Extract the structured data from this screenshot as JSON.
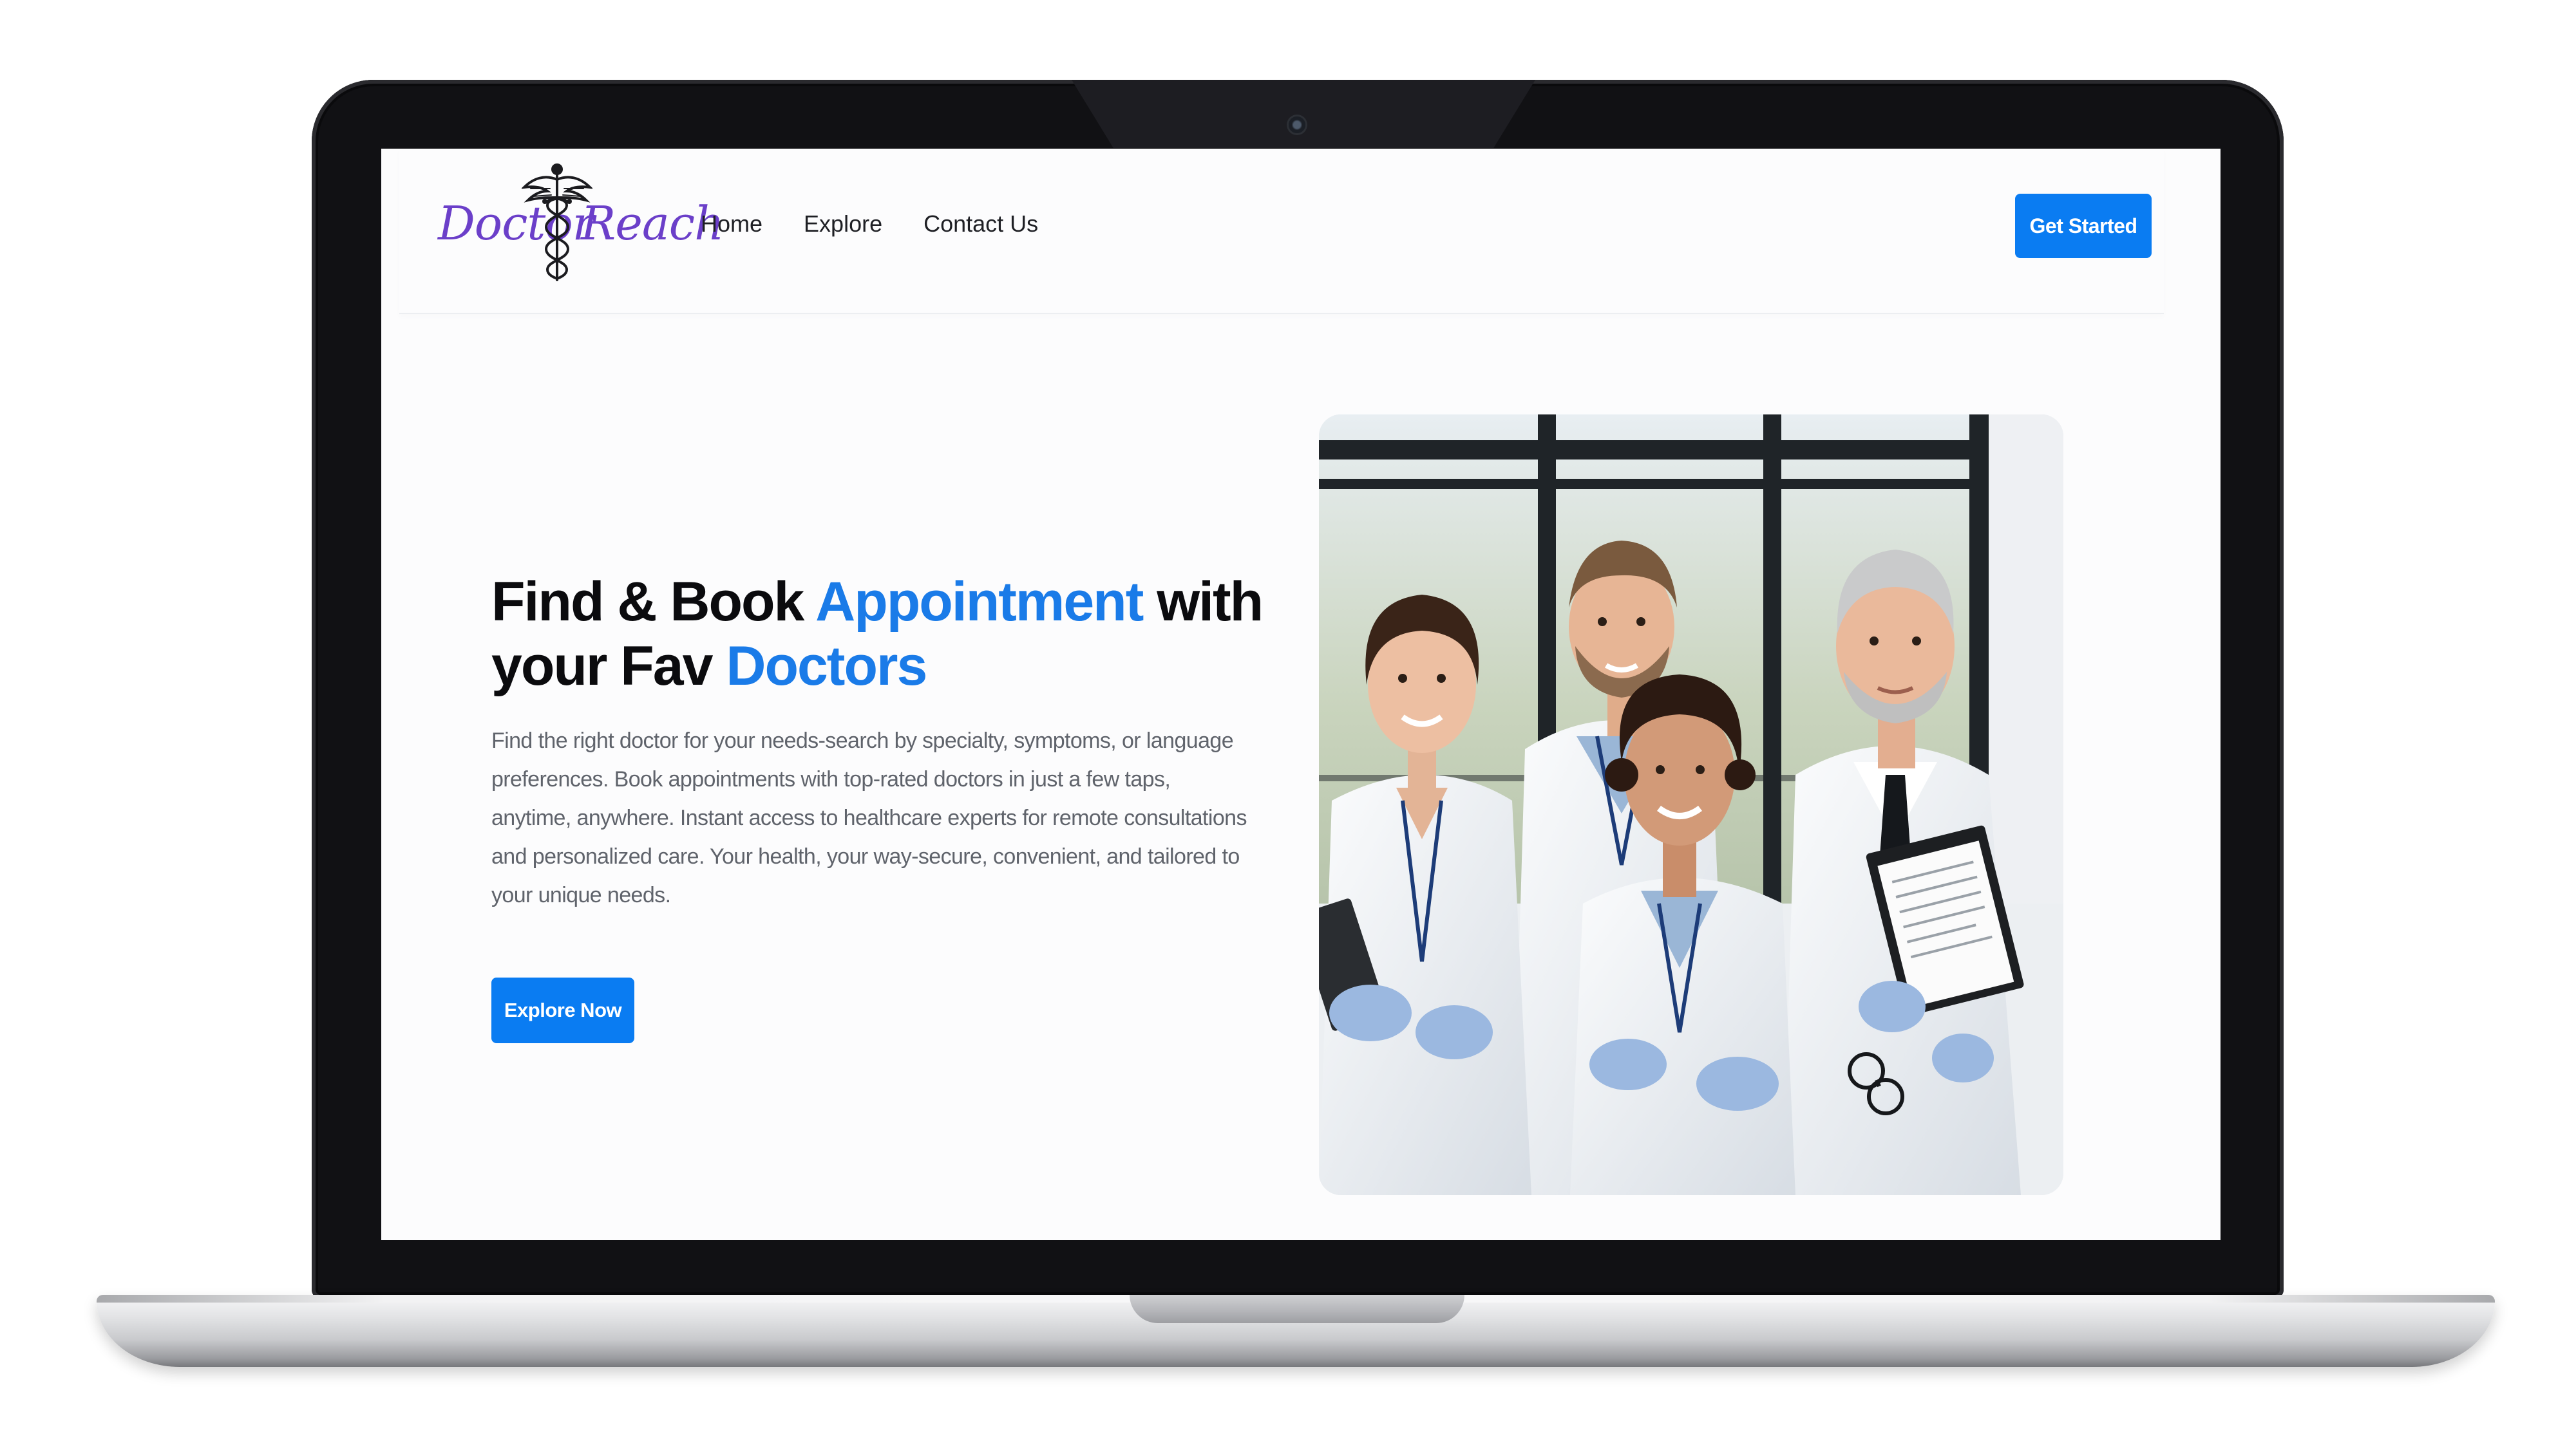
{
  "brand": {
    "logo_word_left": "Doctor",
    "logo_word_right": "Reach"
  },
  "nav": {
    "links": [
      "Home",
      "Explore",
      "Contact Us"
    ],
    "cta": "Get Started"
  },
  "hero": {
    "title_part1": "Find & Book ",
    "title_accent1": "Appointment",
    "title_part2": " with your Fav ",
    "title_accent2": "Doctors",
    "description": "Find the right doctor for your needs-search by specialty, symptoms, or language preferences. Book appointments with top-rated doctors in just a few taps, anytime, anywhere. Instant access to healthcare experts for remote consultations and personalized care. Your health, your way-secure, convenient, and tailored to your unique needs.",
    "button": "Explore Now"
  },
  "colors": {
    "accent": "#1a7be8",
    "button": "#0a7cf2",
    "logo": "#6b3fc9",
    "heading": "#0b0b0e",
    "body_text": "#5f636b"
  },
  "icons": {
    "logo_emblem": "caduceus-icon"
  }
}
